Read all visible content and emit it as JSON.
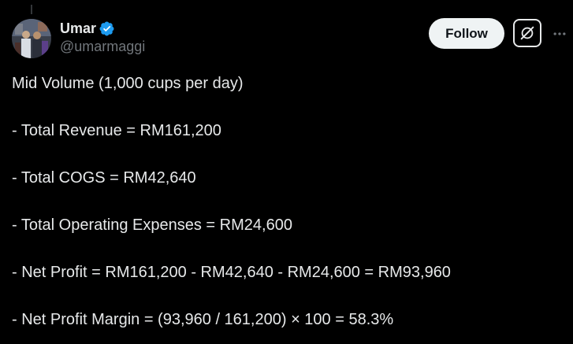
{
  "author": {
    "display_name": "Umar",
    "handle": "@umarmaggi",
    "verified": true,
    "verified_color": "#1d9bf0"
  },
  "actions": {
    "follow_label": "Follow",
    "grok_icon": "grok-icon",
    "more_icon": "more-horizontal-icon"
  },
  "tweet": {
    "lines": [
      "Mid Volume (1,000 cups per day)",
      "- Total Revenue = RM161,200",
      "- Total COGS = RM42,640",
      "- Total Operating Expenses = RM24,600",
      "- Net Profit = RM161,200 - RM42,640 - RM24,600 = RM93,960",
      "- Net Profit Margin = (93,960 / 161,200) × 100 = 58.3%"
    ]
  },
  "colors": {
    "background": "#000000",
    "text_primary": "#e7e9ea",
    "text_secondary": "#71767b",
    "follow_bg": "#eff3f4",
    "follow_text": "#0f1419"
  }
}
